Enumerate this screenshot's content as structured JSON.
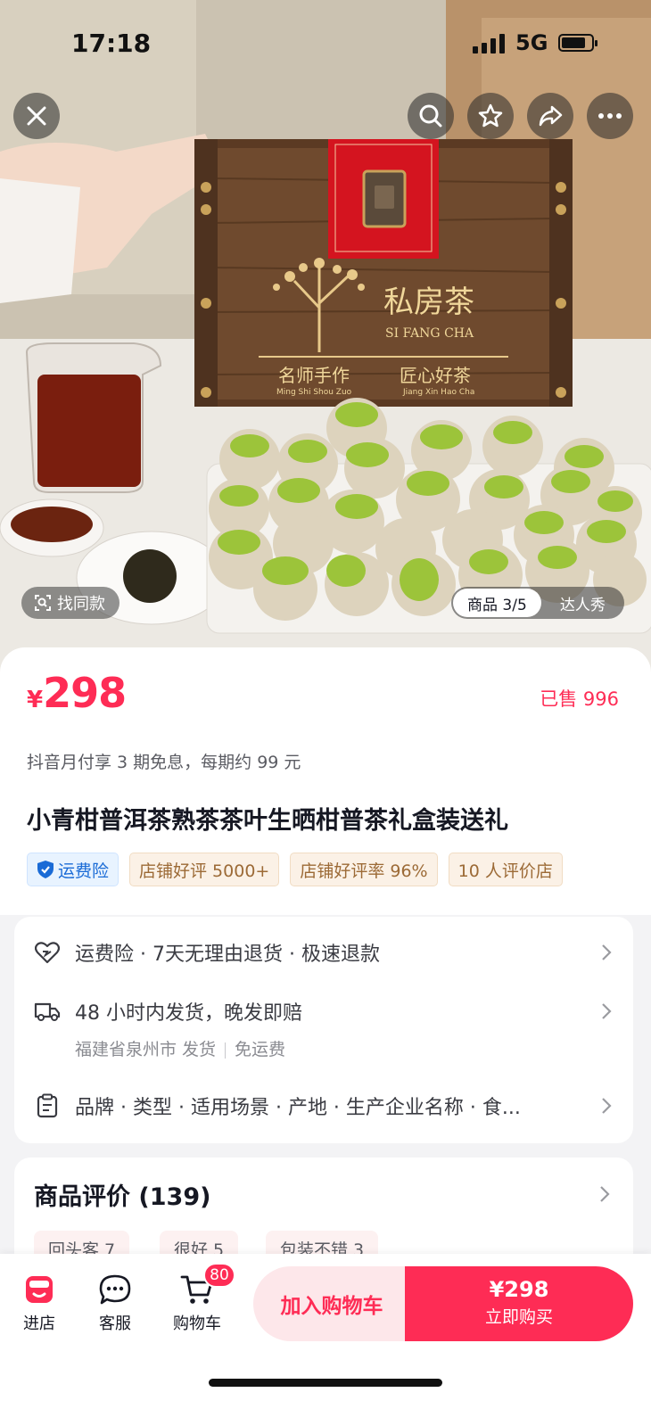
{
  "status_bar": {
    "time": "17:18",
    "network": "5G"
  },
  "gallery": {
    "find_similar_label": "找同款",
    "page_indicator": "商品 3/5",
    "influencer_tab": "达人秀",
    "box_brand_cn": "私房茶",
    "box_brand_en": "SI FANG CHA",
    "box_slogan_left_cn": "名师手作",
    "box_slogan_left_en": "Ming Shi Shou Zuo",
    "box_slogan_right_cn": "匠心好茶",
    "box_slogan_right_en": "Jiang Xin Hao Cha"
  },
  "product": {
    "currency": "¥",
    "price": "298",
    "sold": "已售 996",
    "installment": "抖音月付享 3 期免息，每期约 99 元",
    "title": "小青柑普洱茶熟茶茶叶生晒柑普茶礼盒装送礼",
    "tags": [
      {
        "label": "运费险",
        "style": "blue"
      },
      {
        "label": "店铺好评 5000+",
        "style": "orange"
      },
      {
        "label": "店铺好评率 96%",
        "style": "orange"
      },
      {
        "label": "10 人评价店",
        "style": "orange"
      }
    ]
  },
  "services": {
    "guarantee": "运费险 · 7天无理由退货 · 极速退款",
    "shipping": "48 小时内发货，晚发即赔",
    "ship_from": "福建省泉州市 发货",
    "shipping_fee": "免运费",
    "params": "品牌 · 类型 · 适用场景 · 产地 · 生产企业名称 · 食..."
  },
  "reviews": {
    "title": "商品评价 (139)",
    "chips": [
      "回头客 7",
      "很好 5",
      "包装不错 3"
    ]
  },
  "bottom_bar": {
    "store": "进店",
    "service": "客服",
    "cart": "购物车",
    "cart_badge": "80",
    "add_to_cart": "加入购物车",
    "buy_price": "¥298",
    "buy_now": "立即购买"
  },
  "colors": {
    "accent": "#fe2c55",
    "accent_light": "#fde7ea",
    "tag_blue": "#1a6bd6",
    "tag_orange": "#9c6a36"
  }
}
